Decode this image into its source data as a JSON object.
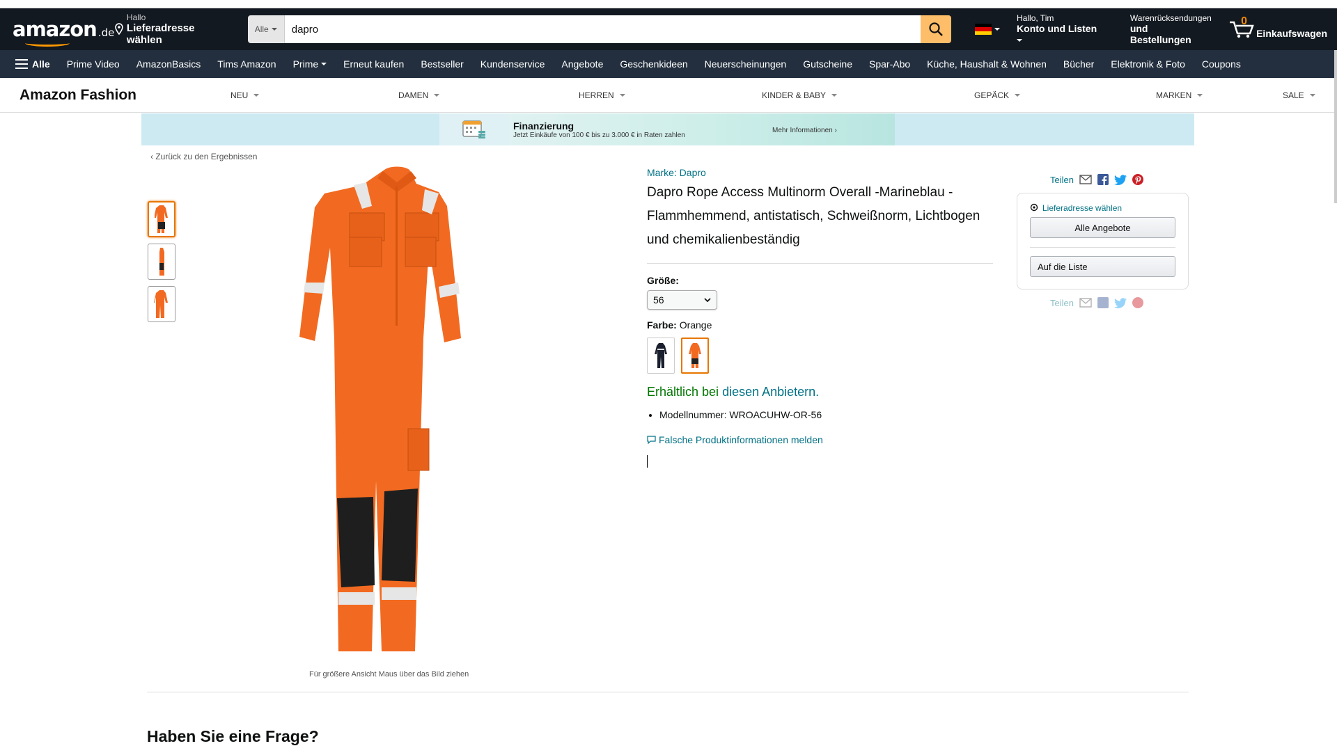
{
  "header": {
    "logo_text": "amazon",
    "logo_tld": ".de",
    "deliver_small": "Hallo",
    "deliver_big": "Lieferadresse wählen",
    "search_category": "Alle",
    "search_value": "dapro",
    "account_small": "Hallo, Tim",
    "account_big": "Konto und Listen",
    "returns_small": "Warenrücksendungen",
    "returns_big": "und Bestellungen",
    "cart_count": "0",
    "cart_label": "Einkaufswagen"
  },
  "subnav": {
    "alle": "Alle",
    "items": [
      "Prime Video",
      "AmazonBasics",
      "Tims Amazon",
      "Prime",
      "Erneut kaufen",
      "Bestseller",
      "Kundenservice",
      "Angebote",
      "Geschenkideen",
      "Neuerscheinungen",
      "Gutscheine",
      "Spar-Abo",
      "Küche, Haushalt & Wohnen",
      "Bücher",
      "Elektronik & Foto",
      "Coupons"
    ]
  },
  "fashion": {
    "brand": "Amazon Fashion",
    "items": [
      "NEU",
      "DAMEN",
      "HERREN",
      "KINDER & BABY",
      "GEPÄCK",
      "MARKEN",
      "SALE"
    ]
  },
  "promo": {
    "title": "Finanzierung",
    "subtitle": "Jetzt Einkäufe von 100 € bis zu 3.000 € in Raten zahlen",
    "more": "Mehr Informationen ›"
  },
  "back_link": "‹ Zurück zu den Ergebnissen",
  "image_caption": "Für größere Ansicht Maus über das Bild ziehen",
  "product": {
    "brand": "Marke: Dapro",
    "title": "Dapro Rope Access Multinorm Overall -Marineblau - Flammhemmend, antistatisch, Schweißnorm, Lichtbogen und chemikalienbeständig",
    "size_label": "Größe:",
    "size_value": "56",
    "color_label": "Farbe:",
    "color_value": "Orange",
    "avail_prefix": "Erhältlich bei ",
    "avail_link": "diesen Anbietern.",
    "model": "Modellnummer: WROACUHW-OR-56",
    "report": "Falsche Produktinformationen melden"
  },
  "share_label": "Teilen",
  "buybox": {
    "location": "Lieferadresse wählen",
    "all_offers": "Alle Angebote",
    "wishlist": "Auf die Liste"
  },
  "faq_title": "Haben Sie eine Frage?",
  "colors": {
    "nav_dark": "#131921",
    "nav_sub": "#232f3e",
    "accent": "#ff9900",
    "link": "#007185",
    "product_orange": "#f26a21"
  }
}
